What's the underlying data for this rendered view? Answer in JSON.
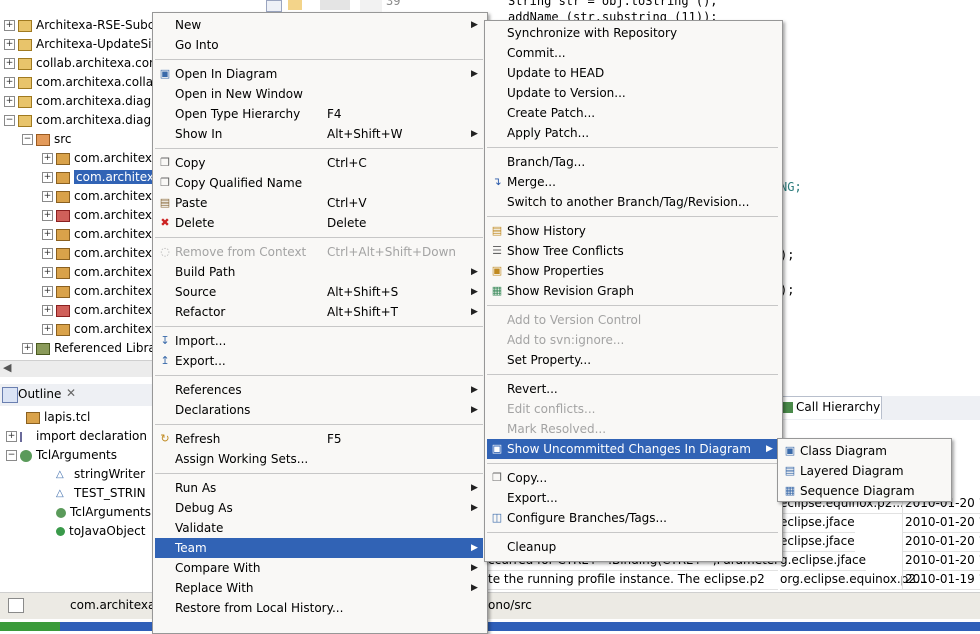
{
  "explorer": {
    "projects": [
      "Architexa-RSE-Subc",
      "Architexa-UpdateSit",
      "collab.architexa.con",
      "com.architexa.collab",
      "com.architexa.diagr",
      "com.architexa.diagr"
    ],
    "src_label": "src",
    "packages": [
      "com.architex",
      "com.architex",
      "com.architex",
      "com.architex",
      "com.architex",
      "com.architex",
      "com.architex",
      "com.architex",
      "com.architex",
      "com.architex"
    ],
    "referenced_label": "Referenced Libra"
  },
  "editor": {
    "line_number": "39",
    "code_lines": [
      "String str = obj.toString ();",
      "addName (str.substring (11));",
      "NG;",
      ");",
      ");"
    ]
  },
  "outline": {
    "tab_label": "Outline",
    "items": [
      "lapis.tcl",
      "import declaration",
      "TclArguments",
      "stringWriter",
      "TEST_STRIN",
      "TclArguments",
      "toJavaObject"
    ]
  },
  "context_menu": {
    "items": [
      {
        "label": "New",
        "submenu": true
      },
      {
        "label": "Go Into"
      },
      {
        "sep": true
      },
      {
        "label": "Open In Diagram",
        "submenu": true,
        "icon": "diagram-icon"
      },
      {
        "label": "Open in New Window"
      },
      {
        "label": "Open Type Hierarchy",
        "accel": "F4"
      },
      {
        "label": "Show In",
        "accel": "Alt+Shift+W",
        "submenu": true
      },
      {
        "sep": true
      },
      {
        "label": "Copy",
        "accel": "Ctrl+C",
        "icon": "copy-icon"
      },
      {
        "label": "Copy Qualified Name",
        "icon": "copy-icon"
      },
      {
        "label": "Paste",
        "accel": "Ctrl+V",
        "icon": "paste-icon"
      },
      {
        "label": "Delete",
        "accel": "Delete",
        "icon": "delete-icon"
      },
      {
        "sep": true
      },
      {
        "label": "Remove from Context",
        "accel": "Ctrl+Alt+Shift+Down",
        "disabled": true,
        "icon": "remove-context-icon"
      },
      {
        "label": "Build Path",
        "submenu": true
      },
      {
        "label": "Source",
        "accel": "Alt+Shift+S",
        "submenu": true
      },
      {
        "label": "Refactor",
        "accel": "Alt+Shift+T",
        "submenu": true
      },
      {
        "sep": true
      },
      {
        "label": "Import...",
        "icon": "import-icon"
      },
      {
        "label": "Export...",
        "icon": "export-icon"
      },
      {
        "sep": true
      },
      {
        "label": "References",
        "submenu": true
      },
      {
        "label": "Declarations",
        "submenu": true
      },
      {
        "sep": true
      },
      {
        "label": "Refresh",
        "accel": "F5",
        "icon": "refresh-icon"
      },
      {
        "label": "Assign Working Sets..."
      },
      {
        "sep": true
      },
      {
        "label": "Run As",
        "submenu": true
      },
      {
        "label": "Debug As",
        "submenu": true
      },
      {
        "label": "Validate"
      },
      {
        "label": "Team",
        "submenu": true,
        "highlighted": true
      },
      {
        "label": "Compare With",
        "submenu": true
      },
      {
        "label": "Replace With",
        "submenu": true
      },
      {
        "label": "Restore from Local History..."
      }
    ]
  },
  "team_menu": {
    "items": [
      {
        "label": "Synchronize with Repository"
      },
      {
        "label": "Commit..."
      },
      {
        "label": "Update to HEAD"
      },
      {
        "label": "Update to Version..."
      },
      {
        "label": "Create Patch..."
      },
      {
        "label": "Apply Patch..."
      },
      {
        "sep": true
      },
      {
        "label": "Branch/Tag..."
      },
      {
        "label": "Merge...",
        "icon": "merge-icon"
      },
      {
        "label": "Switch to another Branch/Tag/Revision..."
      },
      {
        "sep": true
      },
      {
        "label": "Show History",
        "icon": "history-icon"
      },
      {
        "label": "Show Tree Conflicts",
        "icon": "tree-conflicts-icon"
      },
      {
        "label": "Show Properties",
        "icon": "properties-icon"
      },
      {
        "label": "Show Revision Graph",
        "icon": "revision-graph-icon"
      },
      {
        "sep": true
      },
      {
        "label": "Add to Version Control",
        "disabled": true
      },
      {
        "label": "Add to svn:ignore...",
        "disabled": true
      },
      {
        "label": "Set Property..."
      },
      {
        "sep": true
      },
      {
        "label": "Revert..."
      },
      {
        "label": "Edit conflicts...",
        "disabled": true
      },
      {
        "label": "Mark Resolved...",
        "disabled": true
      },
      {
        "label": "Show Uncommitted Changes In Diagram",
        "submenu": true,
        "highlighted": true,
        "icon": "diagram-icon"
      },
      {
        "sep": true
      },
      {
        "label": "Copy...",
        "icon": "copy-icon"
      },
      {
        "label": "Export..."
      },
      {
        "label": "Configure Branches/Tags...",
        "icon": "branches-icon"
      },
      {
        "sep": true
      },
      {
        "label": "Cleanup"
      }
    ]
  },
  "diagram_menu": {
    "items": [
      {
        "label": "Class Diagram",
        "icon": "class-diagram-icon"
      },
      {
        "label": "Layered Diagram",
        "icon": "layered-diagram-icon"
      },
      {
        "label": "Sequence Diagram",
        "icon": "sequence-diagram-icon"
      }
    ]
  },
  "bottom_view": {
    "tab_label": "Call Hierarchy",
    "rows": [
      {
        "plugin": "eclipse.equinox.p2...",
        "date": "2010-01-20 1"
      },
      {
        "plugin": "eclipse.jface",
        "date": "2010-01-20 1"
      },
      {
        "plugin": "eclipse.jface",
        "date": "2010-01-20 1"
      },
      {
        "message": "ccurred for CTRL+=.Binding(CTRL+=,ParameterizedCommand(Command(org.eclipse.ui.edit.text.zoomIn,Zoom In,",
        "plugin": "g.eclipse.jface",
        "date": "2010-01-20 1"
      },
      {
        "message": "te the running profile instance. The eclipse.p2",
        "plugin": "org.eclipse.equinox.p2...",
        "date": "2010-01-19 1"
      }
    ]
  },
  "statusbar": {
    "left_text": "com.architexa.",
    "right_text": "ono/src"
  }
}
